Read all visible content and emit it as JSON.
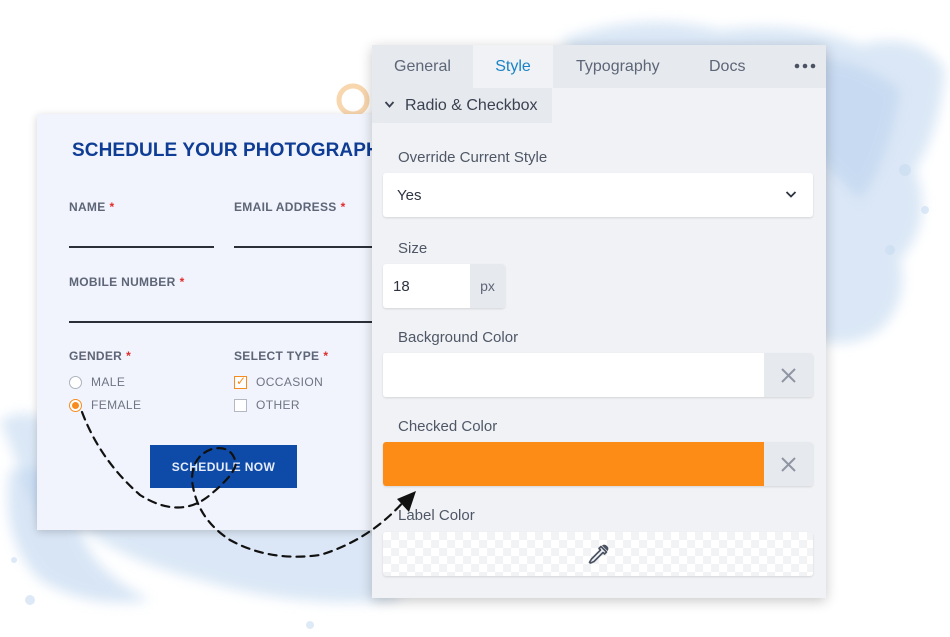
{
  "colors": {
    "accent_orange": "#f78b1d",
    "checked_color": "#fc8c16",
    "brand_blue": "#0e4aa8",
    "title_blue": "#0f3c94",
    "tab_active": "#1b83c5"
  },
  "form": {
    "title": "SCHEDULE YOUR PHOTOGRAPHY",
    "required_mark": "*",
    "name_label": "NAME",
    "email_label": "EMAIL ADDRESS",
    "mobile_label": "MOBILE NUMBER",
    "gender_label": "GENDER",
    "type_label": "SELECT TYPE",
    "gender_options": [
      {
        "label": "MALE",
        "checked": false
      },
      {
        "label": "FEMALE",
        "checked": true
      }
    ],
    "type_options": [
      {
        "label": "OCCASION",
        "checked": true
      },
      {
        "label": "OTHER",
        "checked": false
      }
    ],
    "submit_label": "SCHEDULE NOW"
  },
  "panel": {
    "tabs": [
      "General",
      "Style",
      "Typography",
      "Docs"
    ],
    "active_tab": "Style",
    "more_icon": "more-horizontal-icon",
    "section_title": "Radio & Checkbox",
    "override_label": "Override Current Style",
    "override_value": "Yes",
    "size_label": "Size",
    "size_value": "18",
    "size_unit": "px",
    "background_label": "Background Color",
    "background_value": "",
    "checked_label": "Checked Color",
    "checked_value": "#fc8c16",
    "label_color_label": "Label Color",
    "label_color_icon": "eyedropper-icon"
  }
}
